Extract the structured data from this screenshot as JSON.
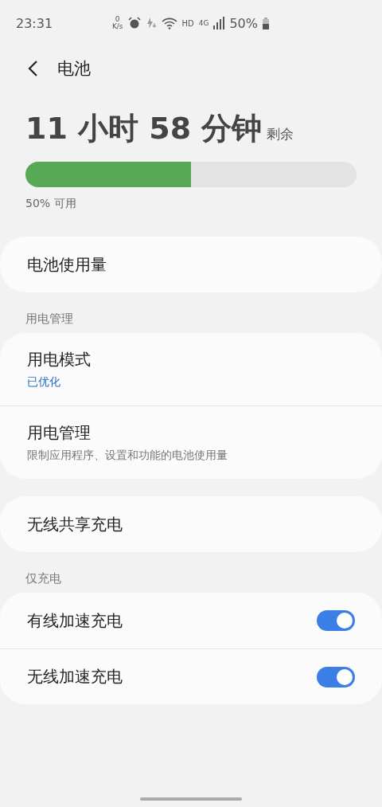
{
  "status_bar": {
    "time": "23:31",
    "net_speed_value": "0",
    "net_speed_unit": "K/s",
    "hd": "HD",
    "network": "4G",
    "battery": "50%"
  },
  "header": {
    "title": "电池"
  },
  "summary": {
    "time_left": "11 小时 58 分钟",
    "suffix": "剩余",
    "level": 0.5,
    "caption": "50% 可用"
  },
  "groups": [
    {
      "items": [
        {
          "kind": "link",
          "title": "电池使用量"
        }
      ]
    },
    {
      "label": "用电管理",
      "items": [
        {
          "kind": "link",
          "title": "用电模式",
          "subtitle": "已优化",
          "subtitle_accent": true
        },
        {
          "kind": "link",
          "title": "用电管理",
          "subtitle": "限制应用程序、设置和功能的电池使用量",
          "subtitle_accent": false
        }
      ]
    },
    {
      "items": [
        {
          "kind": "link",
          "title": "无线共享充电"
        }
      ]
    },
    {
      "label": "仅充电",
      "items": [
        {
          "kind": "toggle",
          "title": "有线加速充电",
          "on": true
        },
        {
          "kind": "toggle",
          "title": "无线加速充电",
          "on": true
        }
      ]
    }
  ]
}
